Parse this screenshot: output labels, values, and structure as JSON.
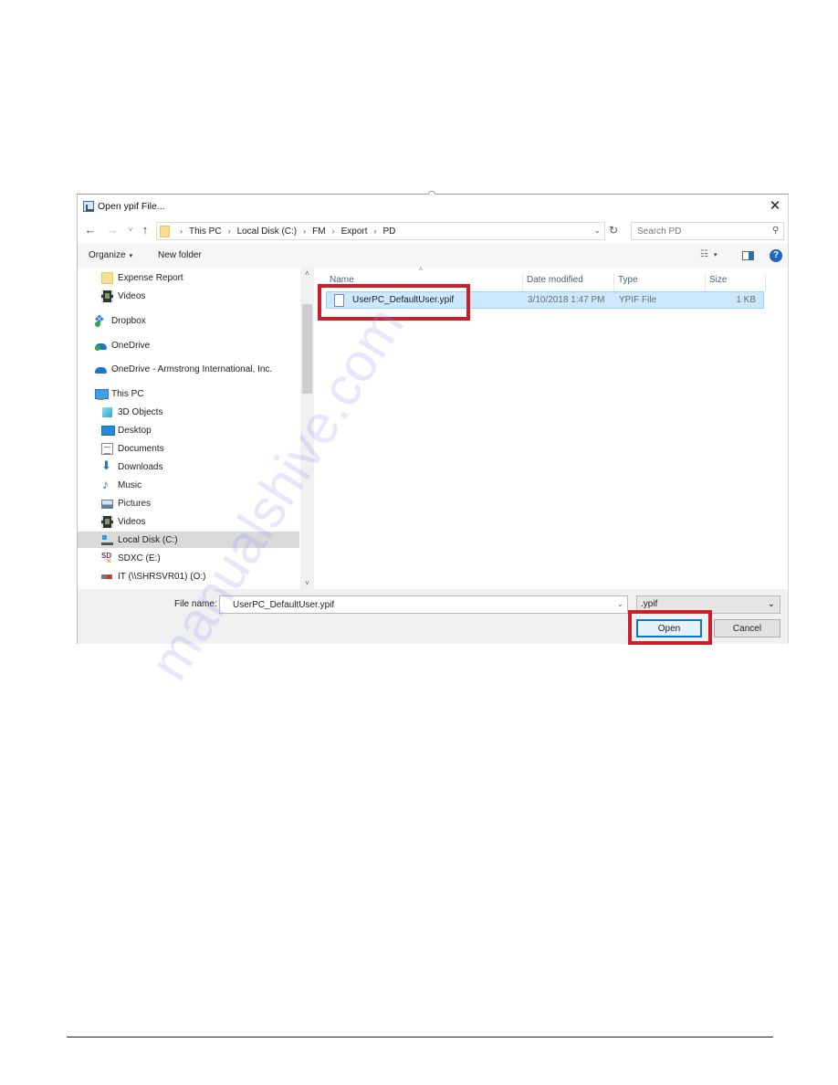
{
  "dialog": {
    "title": "Open ypif File...",
    "close_glyph": "✕"
  },
  "nav": {
    "back_glyph": "←",
    "forward_glyph": "→",
    "recent_glyph": "˅",
    "up_glyph": "↑",
    "breadcrumb": [
      "This PC",
      "Local Disk (C:)",
      "FM",
      "Export",
      "PD"
    ],
    "separator": "›",
    "dropdown_glyph": "⌄",
    "refresh_glyph": "↻",
    "search_placeholder": "Search PD",
    "search_glyph": "⚲"
  },
  "commandbar": {
    "organize_label": "Organize",
    "new_folder_label": "New folder",
    "caret": "▾",
    "view_glyph": "☷",
    "help_glyph": "?"
  },
  "sidebar": {
    "items": [
      {
        "label": "Expense Report",
        "icon": "folder-icon"
      },
      {
        "label": "Videos",
        "icon": "videos-icon"
      },
      {
        "label": "Dropbox",
        "icon": "dropbox-icon"
      },
      {
        "label": "OneDrive",
        "icon": "onedrive-icon"
      },
      {
        "label": "OneDrive - Armstrong International, Inc.",
        "icon": "onedrive-business-icon"
      },
      {
        "label": "This PC",
        "icon": "this-pc-icon"
      },
      {
        "label": "3D Objects",
        "icon": "3d-objects-icon"
      },
      {
        "label": "Desktop",
        "icon": "desktop-icon"
      },
      {
        "label": "Documents",
        "icon": "documents-icon"
      },
      {
        "label": "Downloads",
        "icon": "downloads-icon"
      },
      {
        "label": "Music",
        "icon": "music-icon"
      },
      {
        "label": "Pictures",
        "icon": "pictures-icon"
      },
      {
        "label": "Videos",
        "icon": "videos-icon"
      },
      {
        "label": "Local Disk (C:)",
        "icon": "local-disk-icon",
        "selected": true
      },
      {
        "label": "SDXC (E:)",
        "icon": "sd-card-icon"
      },
      {
        "label": "IT (\\\\SHRSVR01) (O:)",
        "icon": "network-drive-disconnected-icon"
      }
    ],
    "scroll_up_glyph": "˄",
    "scroll_down_glyph": "˅"
  },
  "filelist": {
    "sort_glyph": "^",
    "columns": [
      "Name",
      "Date modified",
      "Type",
      "Size"
    ],
    "rows": [
      {
        "name": "UserPC_DefaultUser.ypif",
        "date": "3/10/2018 1:47 PM",
        "type": "YPIF File",
        "size": "1 KB",
        "selected": true
      }
    ]
  },
  "footer": {
    "file_name_label": "File name:",
    "file_name_value": "UserPC_DefaultUser.ypif",
    "file_type_filter": ".ypif",
    "dropdown_glyph": "⌄",
    "open_label": "Open",
    "cancel_label": "Cancel"
  },
  "annotations": {
    "highlight_color": "#cc1f2a"
  },
  "watermark": "manualshive.com"
}
